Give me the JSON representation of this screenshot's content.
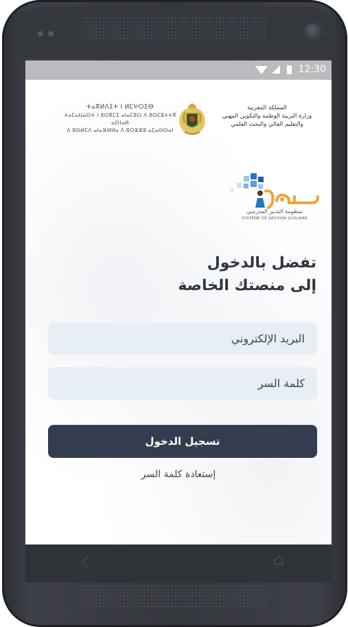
{
  "status_bar": {
    "time": "12:30"
  },
  "header": {
    "amazigh_lines": [
      "ⵜⴰⴳⵍⴷⵉⵜ ⵏ ⵍⵎⵖⵔⵉⴱ",
      "ⵜⴰⵎⴰⵡⴰⵙⵜ ⵏ ⵓⵙⴳⵎⵉ ⴰⵏⴰⵎⵓⵔ ⴷ ⵓⵙⵎⵓⵜⵜⴳ ⴰⵙⵏⴰⵍ",
      "ⴷ ⵓⵙⵍⵎⴷ ⴰⵏⴰⴼⵍⵍⴰ ⴷ ⵓⵔⵣⵣⵓ ⴰⵎⴰⵙⵙⴰⵏ"
    ],
    "arabic_lines": [
      "المملكة المغربية",
      "وزارة التربية الوطنية والتكوين المهني",
      "والتعليم العالي والبحث العلمي"
    ]
  },
  "logo": {
    "name": "مسار",
    "subtitle_ar": "منظومة التدبير المدرسي",
    "subtitle_fr": "SYSTÈME DE GESTION SCOLAIRE"
  },
  "welcome": {
    "line1": "تفضل بالدخول",
    "line2": "إلى منصتك الخاصة"
  },
  "form": {
    "email_placeholder": "البريد الإلكتروني",
    "password_placeholder": "كلمة السر",
    "submit_label": "تسجيل الدخول",
    "forgot_label": "إستعادة كلمة السر"
  },
  "colors": {
    "button": "#343d50",
    "field_bg": "#e8eef6",
    "heading": "#2e3542",
    "logo_orange": "#f3a33a",
    "logo_blue": "#2a73c2"
  },
  "icons": [
    "wifi-icon",
    "signal-icon",
    "battery-icon",
    "coat-of-arms-icon",
    "nav-back-icon",
    "nav-home-icon"
  ]
}
